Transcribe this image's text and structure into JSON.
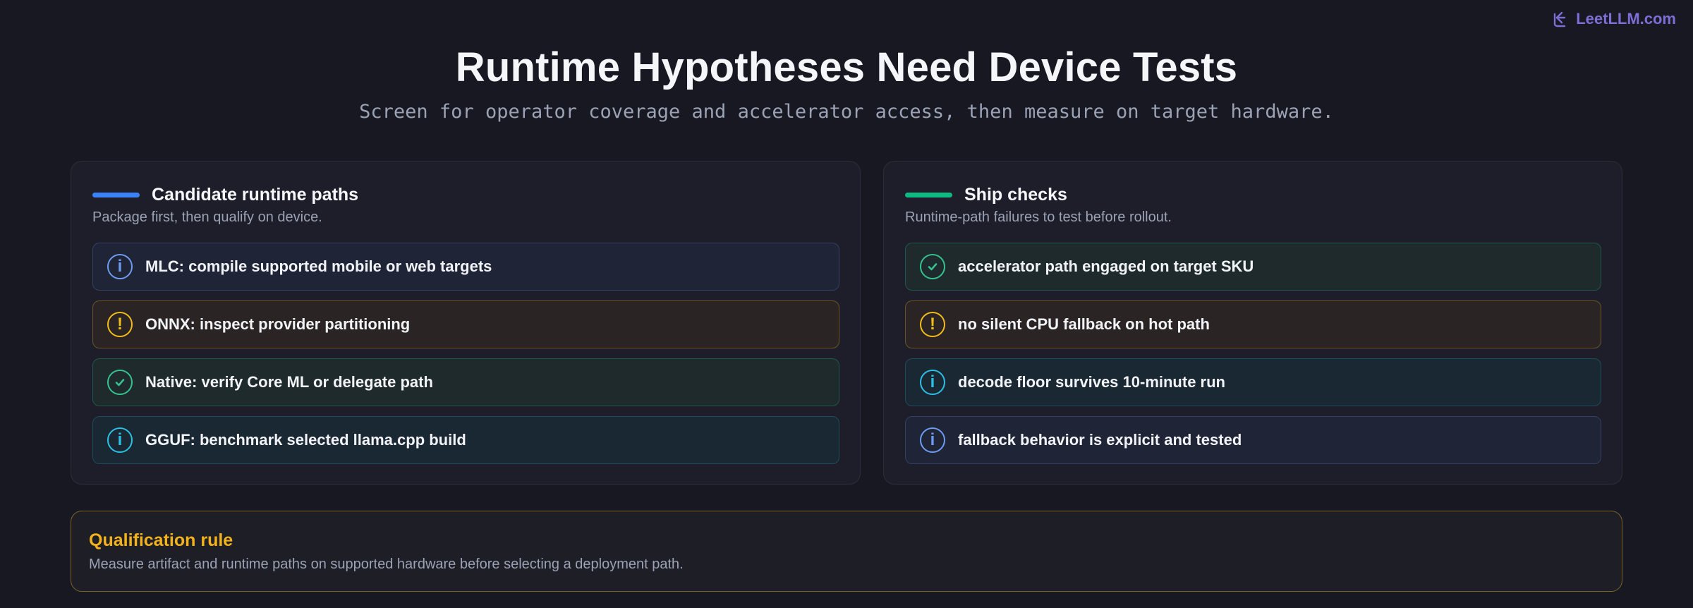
{
  "brand": {
    "name": "LeetLLM.com",
    "icon": "leetllm-logo-icon",
    "color": "#7b6fd6"
  },
  "header": {
    "title": "Runtime Hypotheses Need Device Tests",
    "subtitle": "Screen for operator coverage and accelerator access, then measure on target hardware."
  },
  "panels": [
    {
      "title": "Candidate runtime paths",
      "description": "Package first, then qualify on device.",
      "accent": "#3b82f6",
      "items": [
        {
          "text": "MLC: compile supported mobile or web targets",
          "icon": "info-icon",
          "glyph": "i",
          "tone": "info"
        },
        {
          "text": "ONNX: inspect provider partitioning",
          "icon": "warning-icon",
          "glyph": "!",
          "tone": "warn"
        },
        {
          "text": "Native: verify Core ML or delegate path",
          "icon": "check-icon",
          "glyph": "",
          "tone": "ok"
        },
        {
          "text": "GGUF: benchmark selected llama.cpp build",
          "icon": "info-icon",
          "glyph": "i",
          "tone": "cyan"
        }
      ]
    },
    {
      "title": "Ship checks",
      "description": "Runtime-path failures to test before rollout.",
      "accent": "#10b981",
      "items": [
        {
          "text": "accelerator path engaged on target SKU",
          "icon": "check-icon",
          "glyph": "",
          "tone": "ok"
        },
        {
          "text": "no silent CPU fallback on hot path",
          "icon": "warning-icon",
          "glyph": "!",
          "tone": "warn"
        },
        {
          "text": "decode floor survives 10-minute run",
          "icon": "info-icon",
          "glyph": "i",
          "tone": "cyan"
        },
        {
          "text": "fallback behavior is explicit and tested",
          "icon": "info-icon",
          "glyph": "i",
          "tone": "info"
        }
      ]
    }
  ],
  "rule": {
    "title": "Qualification rule",
    "text": "Measure artifact and runtime paths on supported hardware before selecting a deployment path.",
    "accent": "#f2b21d"
  }
}
